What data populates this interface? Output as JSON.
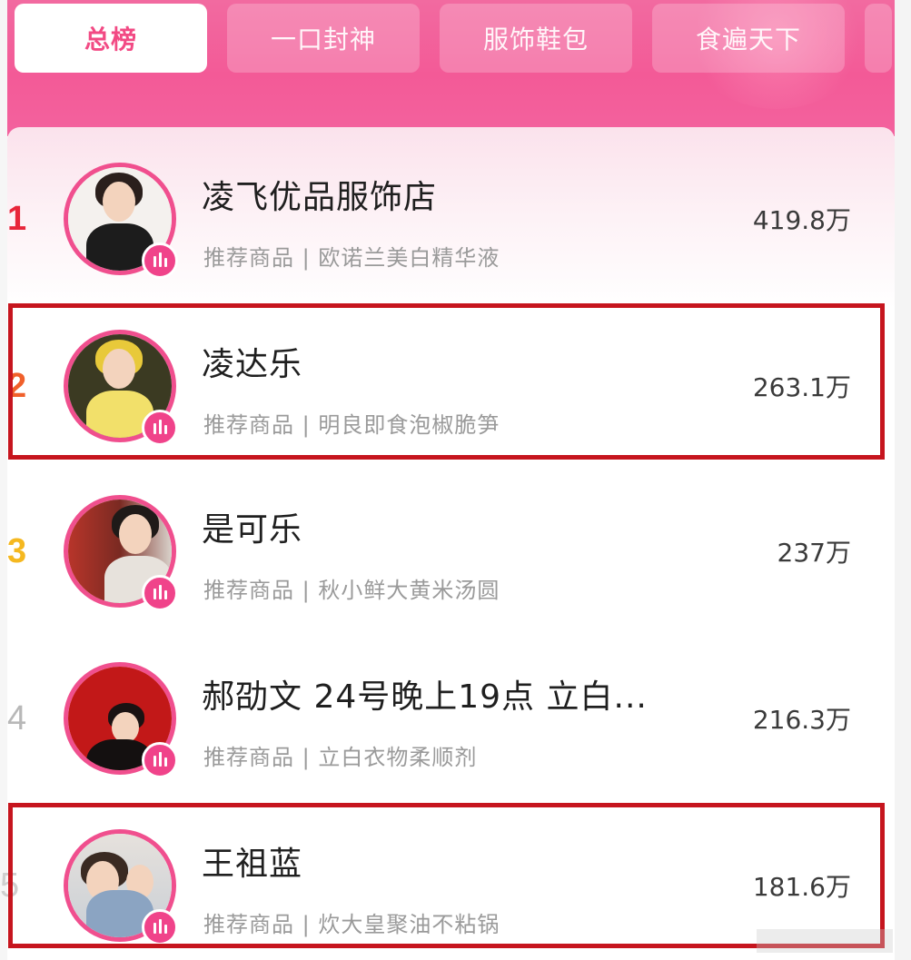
{
  "tabs": [
    {
      "label": "总榜",
      "active": true
    },
    {
      "label": "一口封神",
      "active": false
    },
    {
      "label": "服饰鞋包",
      "active": false
    },
    {
      "label": "食遍天下",
      "active": false
    }
  ],
  "colors": {
    "header": "#f35a97",
    "accent": "#f04f8e",
    "highlight_border": "#c6151e",
    "rank1": "#e8263a",
    "rank2": "#f0602b",
    "rank3": "#f5b820",
    "rank_other": "#b8b8b8"
  },
  "ranking": [
    {
      "rank": "1",
      "name": "凌飞优品服饰店",
      "recommend": "推荐商品 | 欧诺兰美白精华液",
      "count": "419.8万",
      "highlighted": false,
      "badge_icon": "live-icon"
    },
    {
      "rank": "2",
      "name": "凌达乐",
      "recommend": "推荐商品 | 明良即食泡椒脆笋",
      "count": "263.1万",
      "highlighted": true,
      "badge_icon": "live-icon"
    },
    {
      "rank": "3",
      "name": "是可乐",
      "recommend": "推荐商品 | 秋小鲜大黄米汤圆",
      "count": "237万",
      "highlighted": false,
      "badge_icon": "live-icon"
    },
    {
      "rank": "4",
      "name": "郝劭文 24号晚上19点 立白...",
      "recommend": "推荐商品 | 立白衣物柔顺剂",
      "count": "216.3万",
      "highlighted": false,
      "badge_icon": "live-icon"
    },
    {
      "rank": "5",
      "name": "王祖蓝",
      "recommend": "推荐商品 | 炊大皇聚油不粘锅",
      "count": "181.6万",
      "highlighted": true,
      "badge_icon": "live-icon"
    }
  ]
}
